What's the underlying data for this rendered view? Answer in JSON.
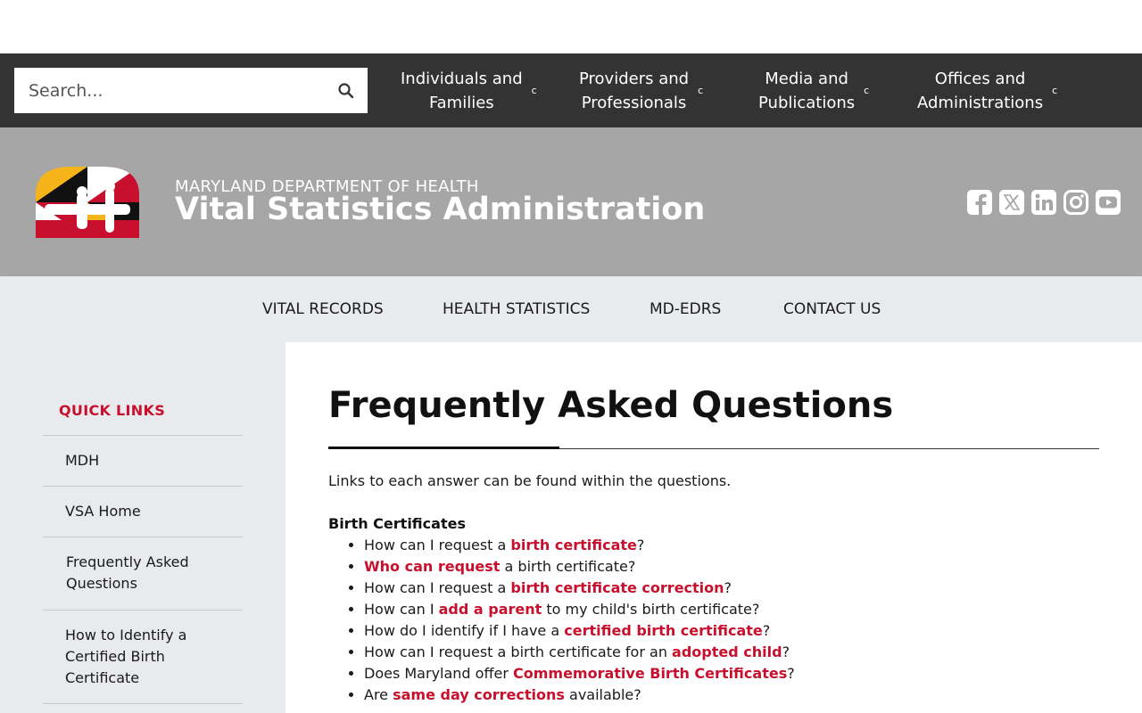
{
  "search": {
    "placeholder": "Search..."
  },
  "top_nav": [
    {
      "line1": "Individuals and",
      "line2": "Families",
      "caret": "c"
    },
    {
      "line1": "Providers and",
      "line2": "Professionals",
      "caret": "c"
    },
    {
      "line1": "Media and",
      "line2": "Publications",
      "caret": "c"
    },
    {
      "line1": "Offices and",
      "line2": "Administrations",
      "caret": "c"
    }
  ],
  "banner": {
    "department": "MARYLAND DEPARTMENT OF HEALTH",
    "agency": "Vital Statistics Administration",
    "social_icons": [
      "facebook-icon",
      "x-twitter-icon",
      "linkedin-icon",
      "instagram-icon",
      "youtube-icon"
    ]
  },
  "sub_nav": [
    "VITAL RECORDS",
    "HEALTH STATISTICS",
    "MD-EDRS",
    "CONTACT US"
  ],
  "sidebar": {
    "title": "QUICK LINKS",
    "items": [
      {
        "line1": "MDH"
      },
      {
        "line1": "VSA Home"
      },
      {
        "line1": "Frequently Asked",
        "line2": "Questions"
      },
      {
        "line1": "How to Identify a",
        "line2": "Certified Birth",
        "line3": "Certificate"
      }
    ]
  },
  "main": {
    "title": "Frequently Asked Questions",
    "intro": "Links to each answer can be found within the questions.",
    "section": "Birth Certificates",
    "questions": [
      {
        "before": "How can I request a ",
        "link": "birth certificate",
        "after": "?"
      },
      {
        "before": "",
        "link": "Who can request",
        "after": " a birth certificate?"
      },
      {
        "before": "How can I request a ",
        "link": "birth certificate correction",
        "after": "?"
      },
      {
        "before": "How can I ",
        "link": "add a parent",
        "after": " to my child's birth certificate?"
      },
      {
        "before": "How do I identify if I have a ",
        "link": "certified birth certificate",
        "after": "?"
      },
      {
        "before": "How can I request a birth certificate for an ",
        "link": "adopted child",
        "after": "?"
      },
      {
        "before": "Does Maryland offer ",
        "link": "Commemorative Birth Certificates",
        "after": "?"
      },
      {
        "before": "Are ",
        "link": "same day corrections",
        "after": " available?"
      }
    ]
  },
  "colors": {
    "topbar": "#333333",
    "banner": "#a6a6a6",
    "subnav": "#e8eaed",
    "accent": "#c8102e"
  }
}
